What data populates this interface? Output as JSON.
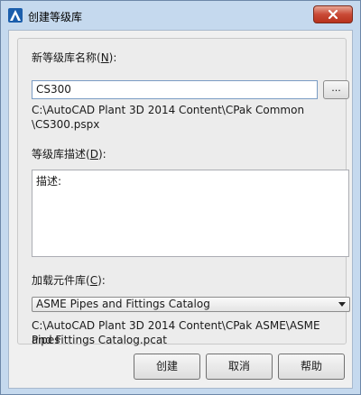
{
  "window": {
    "title": "创建等级库",
    "icon": "autocad-plant-icon",
    "close_icon": "close-icon"
  },
  "form": {
    "name_label": "新等级库名称(",
    "name_mnemonic": "N",
    "name_label_end": "):",
    "name_value": "CS300",
    "browse_label": "...",
    "spec_path_line1": "C:\\AutoCAD Plant 3D 2014 Content\\CPak Common",
    "spec_path_line2": "\\CS300.pspx",
    "desc_label": "等级库描述(",
    "desc_mnemonic": "D",
    "desc_label_end": "):",
    "desc_value": "描述:",
    "lib_label": "加载元件库(",
    "lib_mnemonic": "C",
    "lib_label_end": "):",
    "lib_selected": "ASME Pipes and Fittings Catalog",
    "lib_path_line1": "C:\\AutoCAD Plant 3D 2014 Content\\CPak ASME\\ASME Pipes",
    "lib_path_line2": "and Fittings Catalog.pcat"
  },
  "buttons": {
    "create": "创建",
    "cancel": "取消",
    "help": "帮助"
  }
}
